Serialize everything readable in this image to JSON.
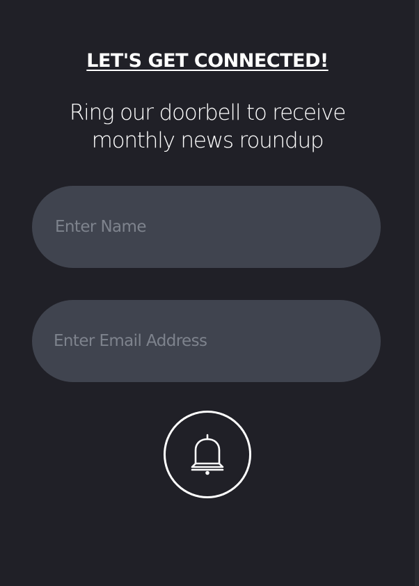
{
  "signup": {
    "heading": "LET'S GET CONNECTED!",
    "subtitle": "Ring our doorbell to receive monthly news roundup",
    "name_placeholder": "Enter Name",
    "email_placeholder": "Enter Email Address",
    "submit_icon": "bell-icon"
  },
  "colors": {
    "background": "#202027",
    "input_background": "#40444f",
    "placeholder": "#7e838d",
    "text": "#ffffff"
  }
}
